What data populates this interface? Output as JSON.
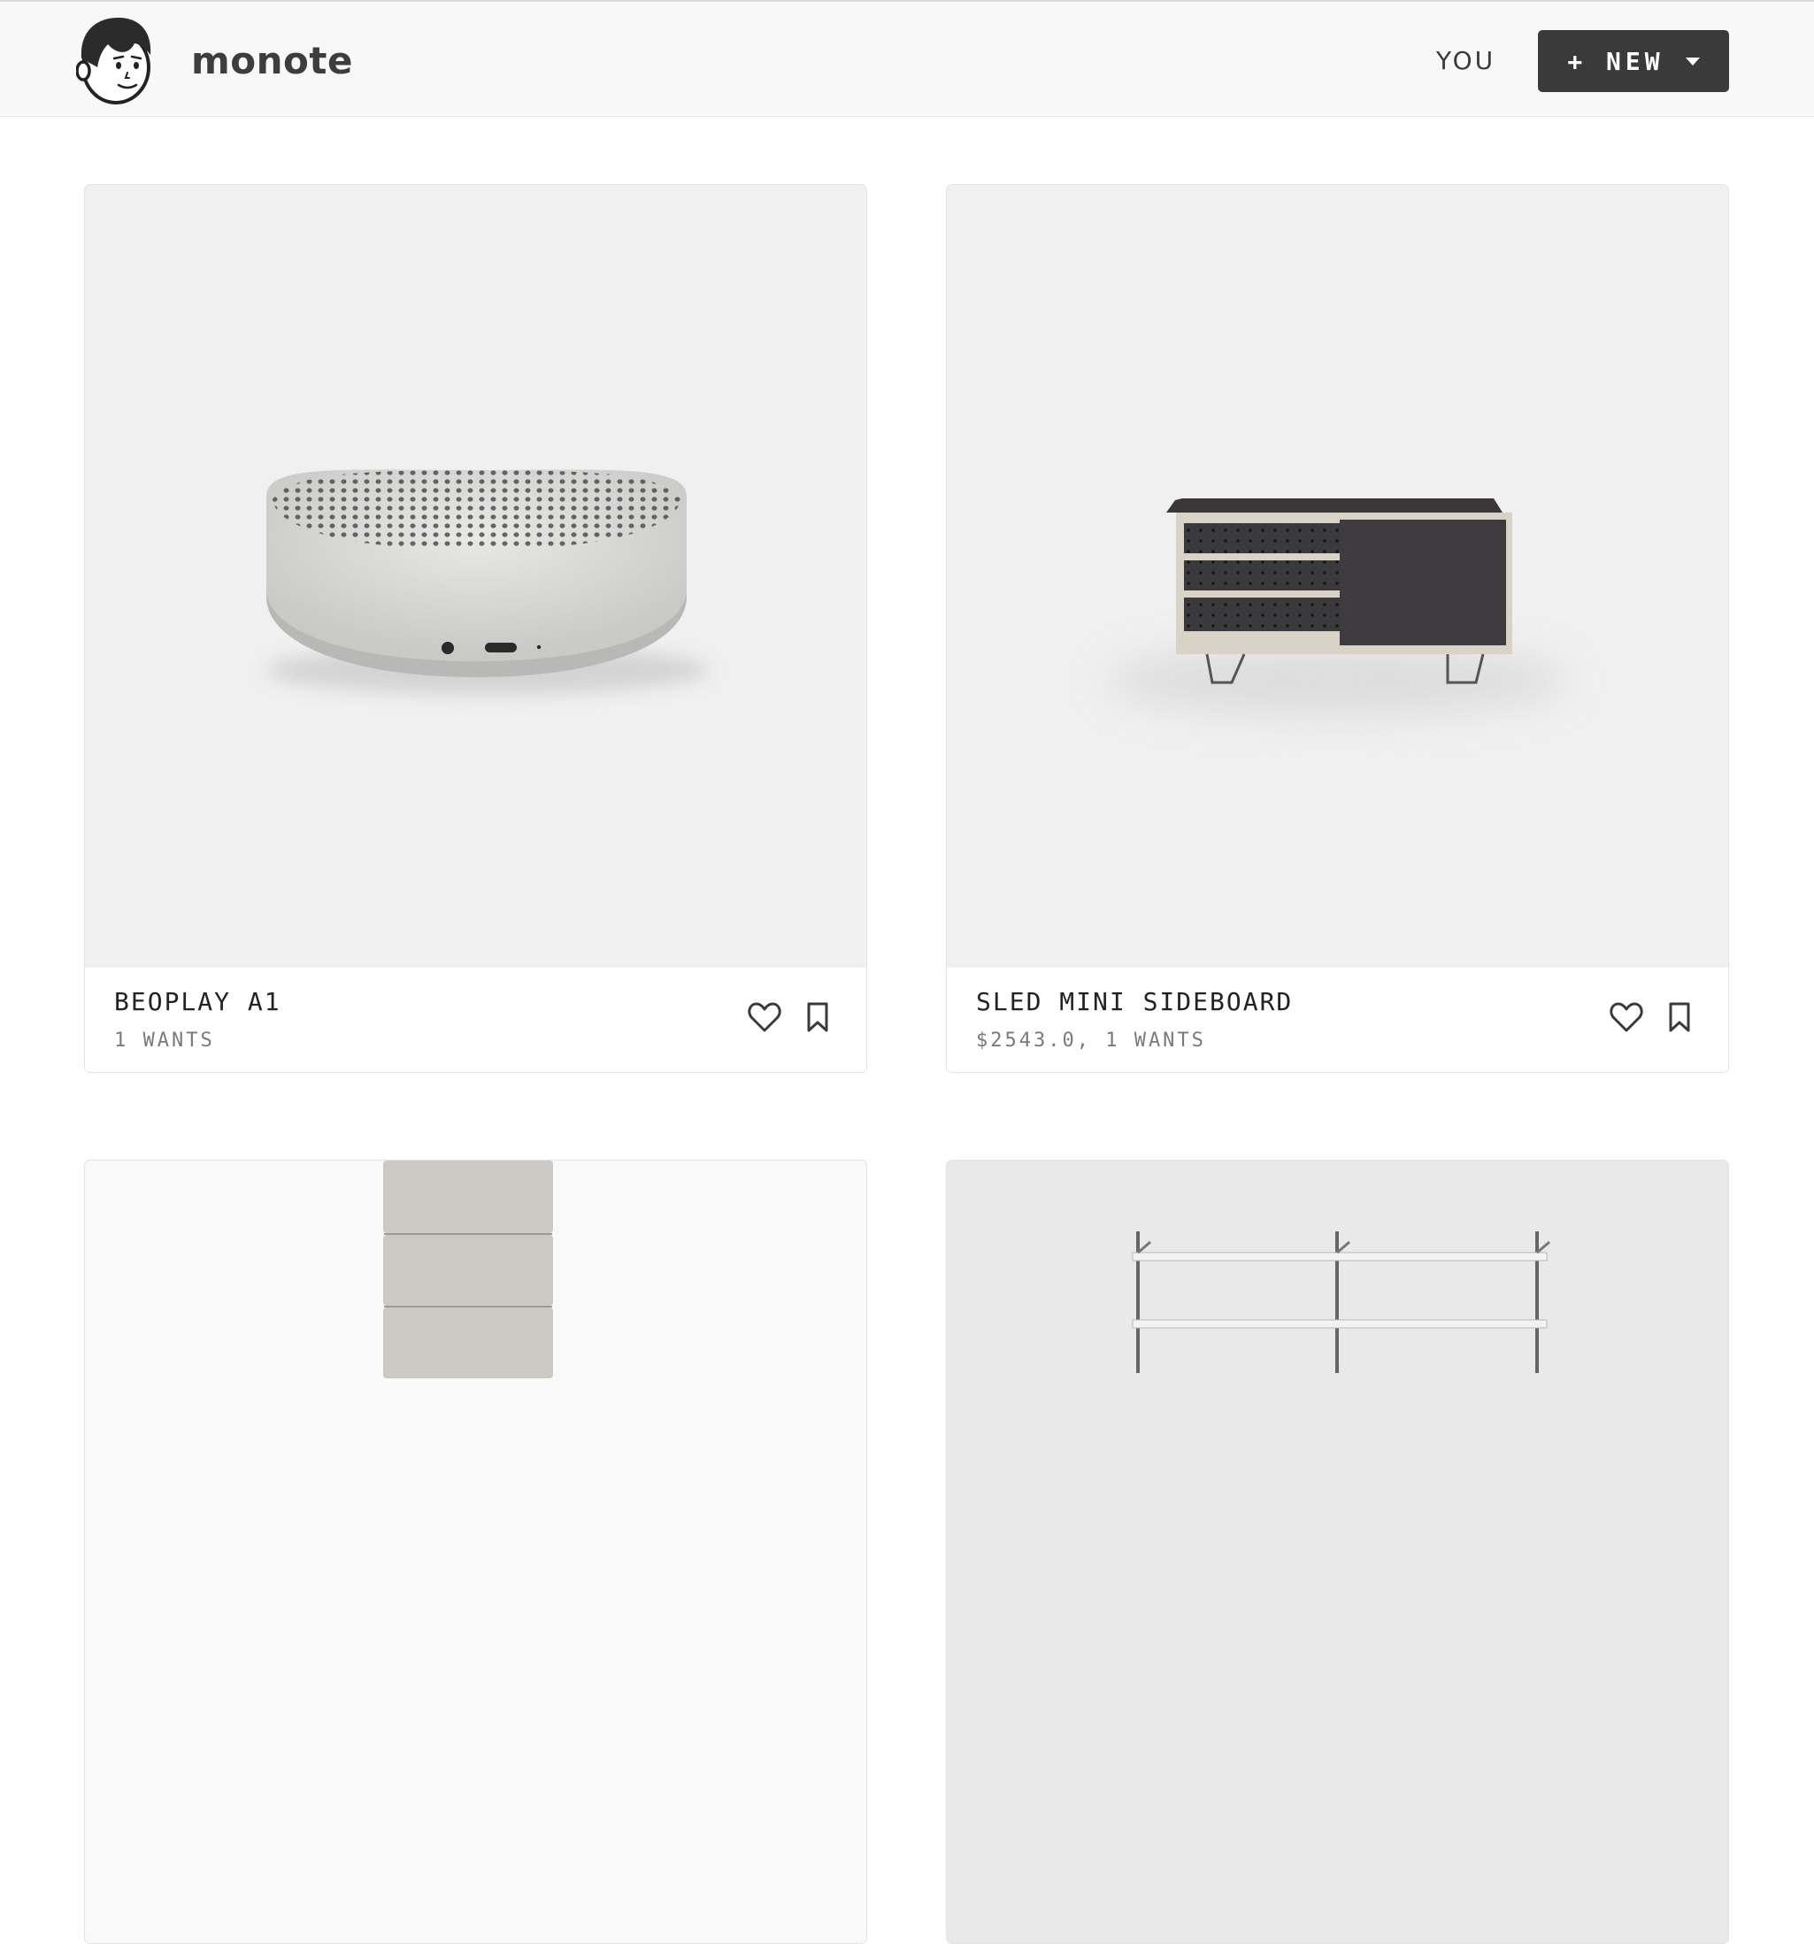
{
  "header": {
    "brand_name": "monote",
    "logo_icon": "face-avatar-icon",
    "nav_you": "YOU",
    "new_button": "+ NEW",
    "new_dropdown_icon": "caret-down-icon"
  },
  "products": [
    {
      "title": "BEOPLAY A1",
      "meta": "1 WANTS",
      "image": "speaker-image",
      "actions": [
        "heart-icon",
        "bookmark-icon"
      ]
    },
    {
      "title": "SLED MINI SIDEBOARD",
      "meta": "$2543.0, 1 WANTS",
      "image": "sideboard-image",
      "actions": [
        "heart-icon",
        "bookmark-icon"
      ]
    },
    {
      "title": "",
      "meta": "",
      "image": "panel-cushion-image"
    },
    {
      "title": "",
      "meta": "",
      "image": "wall-shelf-image"
    }
  ],
  "colors": {
    "header_bg": "#f8f8f8",
    "button_bg": "#3a3a3a",
    "card_image_bg": "#f0f0f0",
    "text": "#222222",
    "meta_text": "#7a7a7a"
  }
}
